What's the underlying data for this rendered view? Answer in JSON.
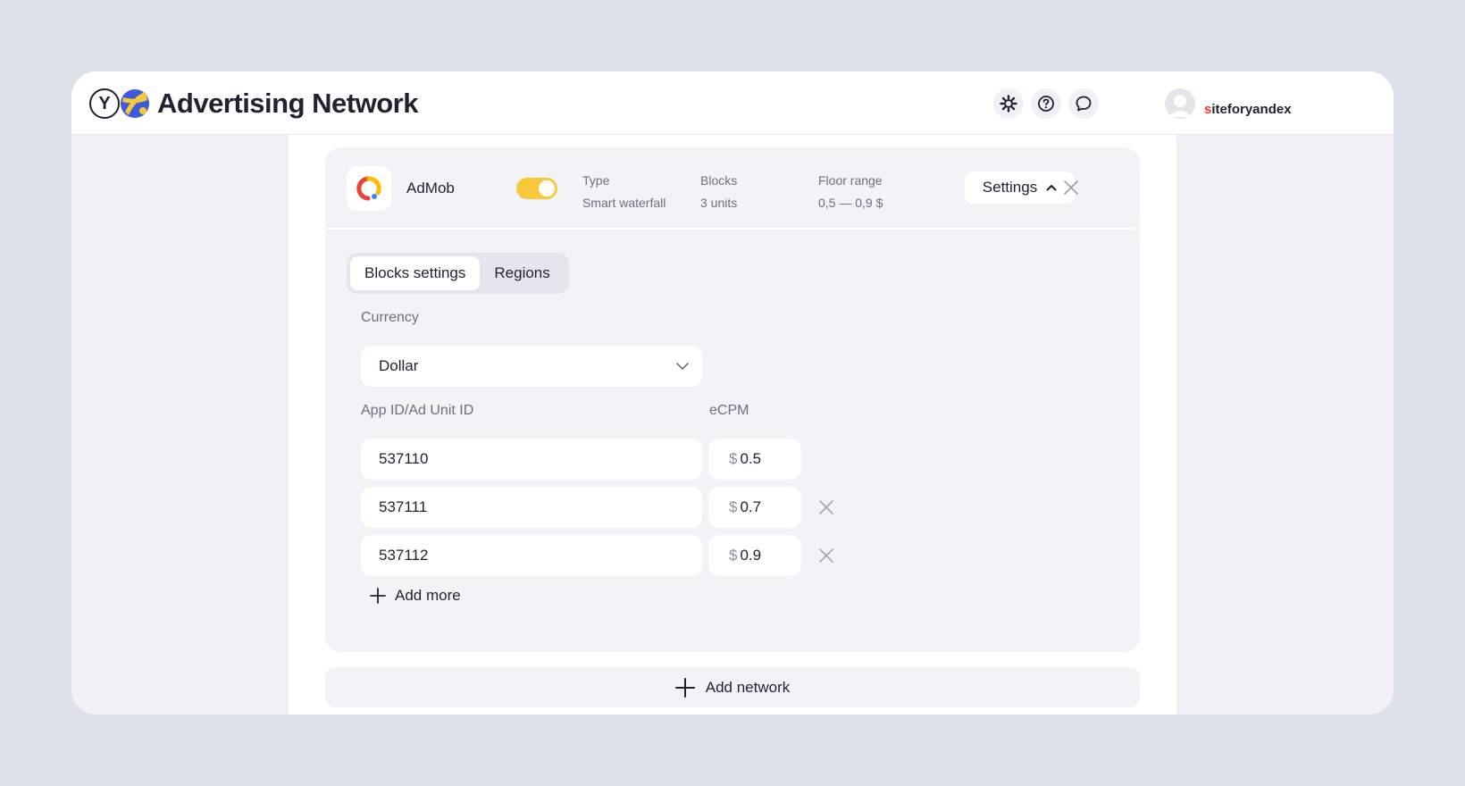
{
  "header": {
    "ya_letter": "Y",
    "title": "Advertising Network",
    "username_first": "s",
    "username_rest": "iteforyandex"
  },
  "network": {
    "name": "AdMob",
    "enabled": true,
    "type_label": "Type",
    "type_value": "Smart waterfall",
    "blocks_label": "Blocks",
    "blocks_value": "3 units",
    "floor_label": "Floor range",
    "floor_value": "0,5 — 0,9 $",
    "settings_label": "Settings"
  },
  "tabs": [
    {
      "label": "Blocks settings",
      "active": true
    },
    {
      "label": "Regions",
      "active": false
    }
  ],
  "currency": {
    "label": "Currency",
    "value": "Dollar"
  },
  "units": {
    "id_header": "App ID/Ad Unit ID",
    "ecpm_header": "eCPM",
    "currency_symbol": "$",
    "rows": [
      {
        "id": "537110",
        "ecpm": "0.5",
        "removable": false
      },
      {
        "id": "537111",
        "ecpm": "0.7",
        "removable": true
      },
      {
        "id": "537112",
        "ecpm": "0.9",
        "removable": true
      }
    ],
    "add_more_label": "Add more"
  },
  "add_network_label": "Add network",
  "colors": {
    "accent_toggle": "#f7c93a",
    "page_bg": "#dce1ec",
    "username_first_letter": "#ff3333"
  }
}
